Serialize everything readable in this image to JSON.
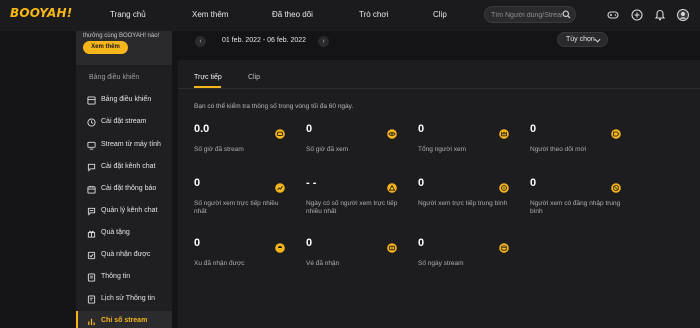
{
  "topbar": {
    "logo": "BOOYAH!",
    "nav": [
      "Trang chủ",
      "Xem thêm",
      "Đã theo dõi",
      "Trò chơi",
      "Clip"
    ],
    "search_placeholder": "Tìm Người dùng/Stream"
  },
  "sidebar": {
    "promo_text": "thưởng cùng BOOYAH! nào!",
    "promo_button": "Xem thêm",
    "heading": "Bảng điều khiển",
    "items": [
      {
        "label": "Bảng điều khiển",
        "icon": "dashboard-icon"
      },
      {
        "label": "Cài đặt stream",
        "icon": "clock-icon"
      },
      {
        "label": "Stream từ máy tính",
        "icon": "monitor-icon"
      },
      {
        "label": "Cài đặt kênh chat",
        "icon": "chat-icon"
      },
      {
        "label": "Cài đặt thông báo",
        "icon": "calendar-icon"
      },
      {
        "label": "Quản lý kênh chat",
        "icon": "manage-chat-icon"
      },
      {
        "label": "Quà tặng",
        "icon": "gift-icon"
      },
      {
        "label": "Quà nhận được",
        "icon": "received-gift-icon"
      },
      {
        "label": "Thông tin",
        "icon": "info-icon"
      },
      {
        "label": "Lịch sử Thông tin",
        "icon": "history-icon"
      },
      {
        "label": "Chỉ số stream",
        "icon": "stats-icon",
        "active": true
      }
    ]
  },
  "date_range": "01 feb. 2022 - 06 feb. 2022",
  "options_label": "Tùy chọn",
  "tabs": {
    "live": "Trực tiếp",
    "clip": "Clip"
  },
  "note": "Bạn có thể kiểm tra thông số trong vòng tối đa 60 ngày.",
  "stats": [
    {
      "value": "0.0",
      "label": "Số giờ đã stream",
      "icon": "tv-icon"
    },
    {
      "value": "0",
      "label": "Số giờ đã xem",
      "icon": "eye-icon"
    },
    {
      "value": "0",
      "label": "Tổng người xem",
      "icon": "crown-icon"
    },
    {
      "value": "0",
      "label": "Người theo dõi mới",
      "icon": "tag-icon"
    },
    {
      "value": "0",
      "label": "Số người xem trực tiếp nhiều nhất",
      "icon": "chart-icon"
    },
    {
      "value": "- -",
      "label": "Ngày có số người xem trực tiếp nhiều nhất",
      "icon": "warning-icon"
    },
    {
      "value": "0",
      "label": "Người xem trực tiếp trung bình",
      "icon": "target-icon"
    },
    {
      "value": "0",
      "label": "Người xem có đăng nhập trung bình",
      "icon": "login-icon"
    },
    {
      "value": "0",
      "label": "Xu đã nhận được",
      "icon": "coin-icon"
    },
    {
      "value": "0",
      "label": "Vé đã nhận",
      "icon": "ticket-icon"
    },
    {
      "value": "0",
      "label": "Số ngày stream",
      "icon": "calendar-days-icon"
    }
  ],
  "colors": {
    "accent": "#f5b51b",
    "background": "#141416",
    "panel": "#1d1d1f"
  }
}
